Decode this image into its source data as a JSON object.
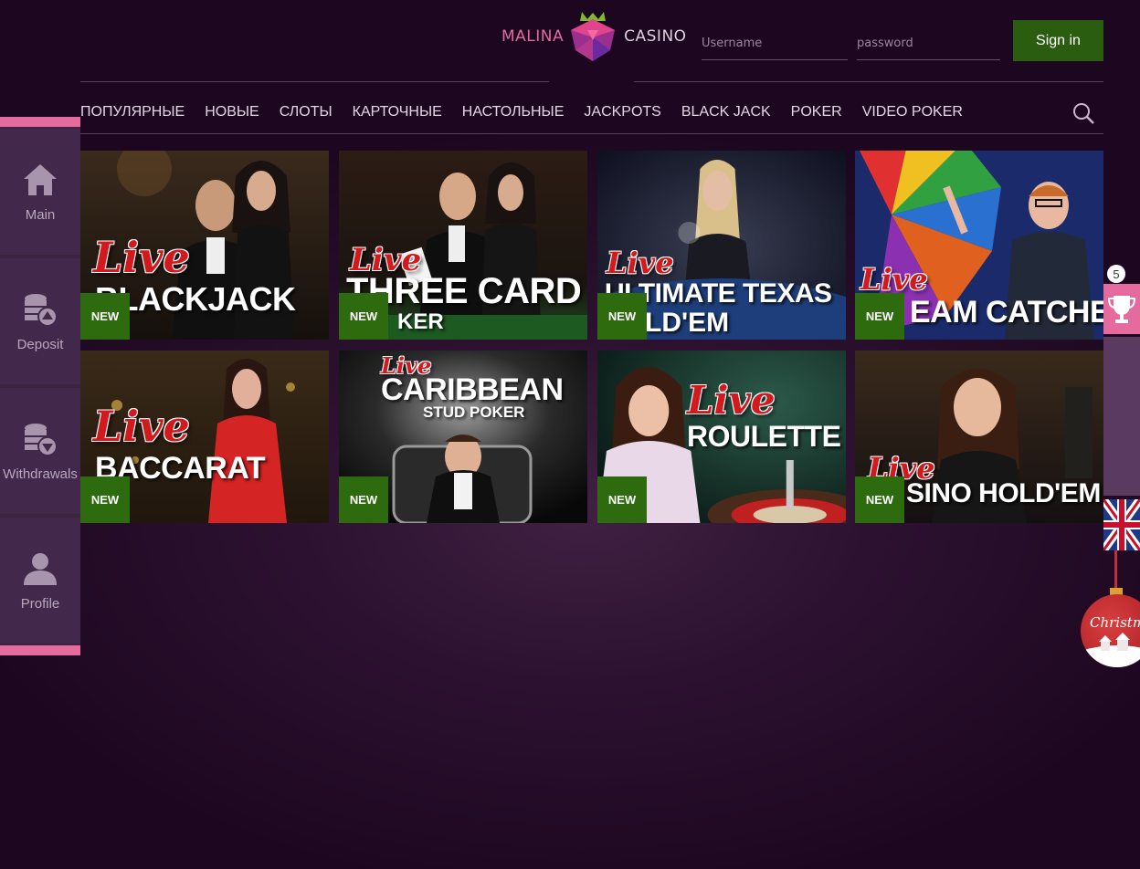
{
  "header": {
    "logo_left": "MALINA",
    "logo_right": "CASINO",
    "username_placeholder": "Username",
    "password_placeholder": "password",
    "signin_label": "Sign in"
  },
  "nav": {
    "items": [
      "ПОПУЛЯРНЫЕ",
      "НОВЫЕ",
      "СЛОТЫ",
      "КАРТОЧНЫЕ",
      "НАСТОЛЬНЫЕ",
      "JACKPOTS",
      "BLACK JACK",
      "POKER",
      "VIDEO POKER"
    ]
  },
  "sidebar": {
    "items": [
      {
        "label": "Main",
        "icon": "home-icon"
      },
      {
        "label": "Deposit",
        "icon": "deposit-coins-icon"
      },
      {
        "label": "Withdrawals",
        "icon": "withdrawals-coins-icon"
      },
      {
        "label": "Profile",
        "icon": "user-icon"
      }
    ]
  },
  "games": [
    {
      "live": "Live",
      "title": "BLACKJACK",
      "sub": "",
      "badge": "NEW"
    },
    {
      "live": "Live",
      "title": "THREE CARD",
      "sub": "KER",
      "badge": "NEW"
    },
    {
      "live": "Live",
      "title": "ULTIMATE TEXAS",
      "sub": "LD'EM",
      "badge": "NEW"
    },
    {
      "live": "Live",
      "title": "EAM CATCHER",
      "sub": "",
      "badge": "NEW"
    },
    {
      "live": "Live",
      "title": "BACCARAT",
      "sub": "",
      "badge": "NEW"
    },
    {
      "live": "Live",
      "title": "CARIBBEAN",
      "sub": "STUD POKER",
      "badge": "NEW"
    },
    {
      "live": "Live",
      "title": "ROULETTE",
      "sub": "",
      "badge": "NEW"
    },
    {
      "live": "Live",
      "title": "SINO HOLD'EM",
      "sub": "",
      "badge": "NEW"
    }
  ],
  "right_rail": {
    "tournaments_count": "5",
    "ornament_text": "Christmas"
  },
  "colors": {
    "accent_pink": "#e56a9e",
    "signin_green": "#2b5d10",
    "badge_green": "#2e6a0e",
    "live_red": "#d2191e"
  }
}
